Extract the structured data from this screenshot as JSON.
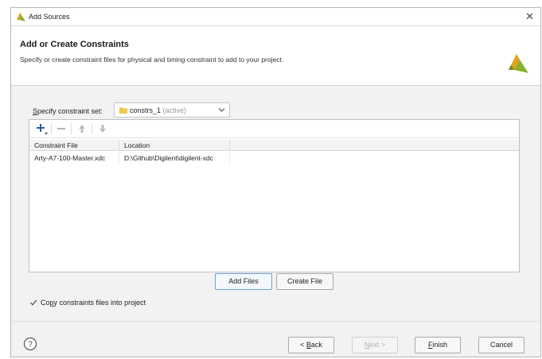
{
  "window": {
    "title": "Add Sources",
    "close_symbol": "✕"
  },
  "header": {
    "title": "Add or Create Constraints",
    "description": "Specify or create constraint files for physical and timing constraint to add to your project."
  },
  "constraint_set": {
    "label_mnemonic": "S",
    "label_rest": "pecify constraint set:",
    "value": "constrs_1",
    "status": "(active)"
  },
  "toolbar": {
    "icons": [
      "plus-icon",
      "minus-icon",
      "arrow-up-icon",
      "arrow-down-icon"
    ]
  },
  "table": {
    "columns": [
      "Constraint File",
      "Location"
    ],
    "rows": [
      [
        "Arty-A7-100-Master.xdc",
        "D:\\Github\\Digilent\\digilent-xdc"
      ]
    ]
  },
  "buttons": {
    "add_files": "Add Files",
    "create_file": "Create File"
  },
  "copy_option": {
    "label_pre": "Co",
    "label_mnemonic": "p",
    "label_post": "y constraints files into project",
    "checked": true
  },
  "footer": {
    "help_symbol": "?",
    "back_mnemonic": "B",
    "back_pre": "< ",
    "back_post": "ack",
    "next_mnemonic": "N",
    "next_post": "ext >",
    "finish_mnemonic": "F",
    "finish_post": "inish",
    "cancel": "Cancel"
  },
  "colors": {
    "accent_blue": "#2b5aa8",
    "brand_green": "#8ab02f",
    "brand_gold": "#e0a21b",
    "dialog_bg": "#f2f2f2"
  }
}
